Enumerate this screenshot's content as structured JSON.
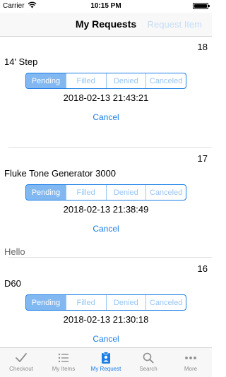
{
  "status_bar": {
    "carrier": "Carrier",
    "time": "10:15 PM",
    "battery": 1.0
  },
  "nav": {
    "title": "My Requests",
    "action": "Request Item"
  },
  "requests": [
    {
      "number": "18",
      "item": "14' Step",
      "status_options": [
        "Pending",
        "Filled",
        "Denied",
        "Canceled"
      ],
      "selected": "Pending",
      "date": "2018-02-13 21:43:21",
      "cancel_label": "Cancel",
      "note": ""
    },
    {
      "number": "17",
      "item": "Fluke Tone Generator 3000",
      "status_options": [
        "Pending",
        "Filled",
        "Denied",
        "Canceled"
      ],
      "selected": "Pending",
      "date": "2018-02-13 21:38:49",
      "cancel_label": "Cancel",
      "note": "Hello"
    },
    {
      "number": "16",
      "item": "D60",
      "status_options": [
        "Pending",
        "Filled",
        "Denied",
        "Canceled"
      ],
      "selected": "Pending",
      "date": "2018-02-13 21:30:18",
      "cancel_label": "Cancel",
      "note": ""
    }
  ],
  "tabs": [
    {
      "label": "Checkout",
      "icon": "checkmark-icon",
      "active": false
    },
    {
      "label": "My Items",
      "icon": "list-icon",
      "active": false
    },
    {
      "label": "My Request",
      "icon": "clipboard-person-icon",
      "active": true
    },
    {
      "label": "Search",
      "icon": "search-icon",
      "active": false
    },
    {
      "label": "More",
      "icon": "more-icon",
      "active": false
    }
  ],
  "colors": {
    "accent": "#1a7ee6",
    "tab_inactive": "#8e8e8e",
    "nav_background": "#f8f8f8"
  }
}
